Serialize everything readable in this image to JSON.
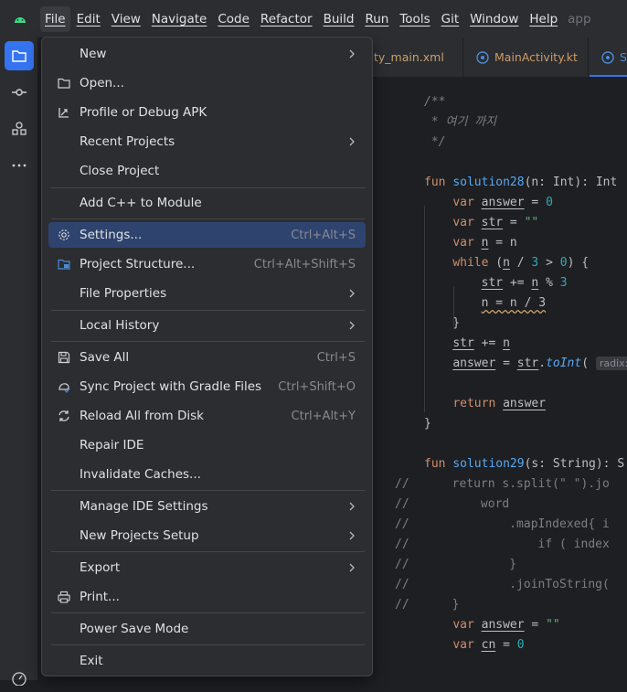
{
  "menubar": {
    "items": [
      "File",
      "Edit",
      "View",
      "Navigate",
      "Code",
      "Refactor",
      "Build",
      "Run",
      "Tools",
      "Git",
      "Window",
      "Help"
    ],
    "project_hint": "app"
  },
  "tabs": [
    {
      "label": "ty_main.xml"
    },
    {
      "label": "MainActivity.kt"
    },
    {
      "label": "S"
    }
  ],
  "file_menu": {
    "items": [
      {
        "label": "New",
        "shortcut": "",
        "submenu": true,
        "icon": ""
      },
      {
        "label": "Open...",
        "shortcut": "",
        "submenu": false,
        "icon": "folder-icon"
      },
      {
        "label": "Profile or Debug APK",
        "shortcut": "",
        "submenu": false,
        "icon": "profile-apk-icon"
      },
      {
        "label": "Recent Projects",
        "shortcut": "",
        "submenu": true,
        "icon": ""
      },
      {
        "label": "Close Project",
        "shortcut": "",
        "submenu": false,
        "icon": ""
      },
      {
        "label": "Add C++ to Module",
        "shortcut": "",
        "submenu": false,
        "icon": ""
      },
      {
        "label": "Settings...",
        "shortcut": "Ctrl+Alt+S",
        "submenu": false,
        "icon": "gear-icon"
      },
      {
        "label": "Project Structure...",
        "shortcut": "Ctrl+Alt+Shift+S",
        "submenu": false,
        "icon": "project-structure-icon"
      },
      {
        "label": "File Properties",
        "shortcut": "",
        "submenu": true,
        "icon": ""
      },
      {
        "label": "Local History",
        "shortcut": "",
        "submenu": true,
        "icon": ""
      },
      {
        "label": "Save All",
        "shortcut": "Ctrl+S",
        "submenu": false,
        "icon": "save-icon"
      },
      {
        "label": "Sync Project with Gradle Files",
        "shortcut": "Ctrl+Shift+O",
        "submenu": false,
        "icon": "gradle-sync-icon"
      },
      {
        "label": "Reload All from Disk",
        "shortcut": "Ctrl+Alt+Y",
        "submenu": false,
        "icon": "reload-icon"
      },
      {
        "label": "Repair IDE",
        "shortcut": "",
        "submenu": false,
        "icon": ""
      },
      {
        "label": "Invalidate Caches...",
        "shortcut": "",
        "submenu": false,
        "icon": ""
      },
      {
        "label": "Manage IDE Settings",
        "shortcut": "",
        "submenu": true,
        "icon": ""
      },
      {
        "label": "New Projects Setup",
        "shortcut": "",
        "submenu": true,
        "icon": ""
      },
      {
        "label": "Export",
        "shortcut": "",
        "submenu": true,
        "icon": ""
      },
      {
        "label": "Print...",
        "shortcut": "",
        "submenu": false,
        "icon": "print-icon"
      },
      {
        "label": "Power Save Mode",
        "shortcut": "",
        "submenu": false,
        "icon": ""
      },
      {
        "label": "Exit",
        "shortcut": "",
        "submenu": false,
        "icon": ""
      }
    ],
    "highlighted_item": "Settings..."
  },
  "code": {
    "lines": [
      "/**",
      " * 여기 까지",
      " */",
      "",
      "fun solution28(n: Int): Int",
      "    var answer = 0",
      "    var str = \"\"",
      "    var n = n",
      "    while (n / 3 > 0) {",
      "        str += n % 3",
      "        n = n / 3",
      "    }",
      "    str += n",
      "    answer = str.toInt( radix:",
      "",
      "    return answer",
      "}",
      "",
      "fun solution29(s: String): S",
      "//      return s.split(\" \").jo",
      "//          word",
      "//              .mapIndexed{ i",
      "//                  if ( index",
      "//              }",
      "//              .joinToString(",
      "//      }",
      "    var answer = \"\"",
      "    var cn = 0"
    ]
  },
  "colors": {
    "accent": "#3574f0",
    "menu_highlight": "#2e436e",
    "menu_bg": "#2b2d30",
    "editor_bg": "#1e1f22"
  }
}
